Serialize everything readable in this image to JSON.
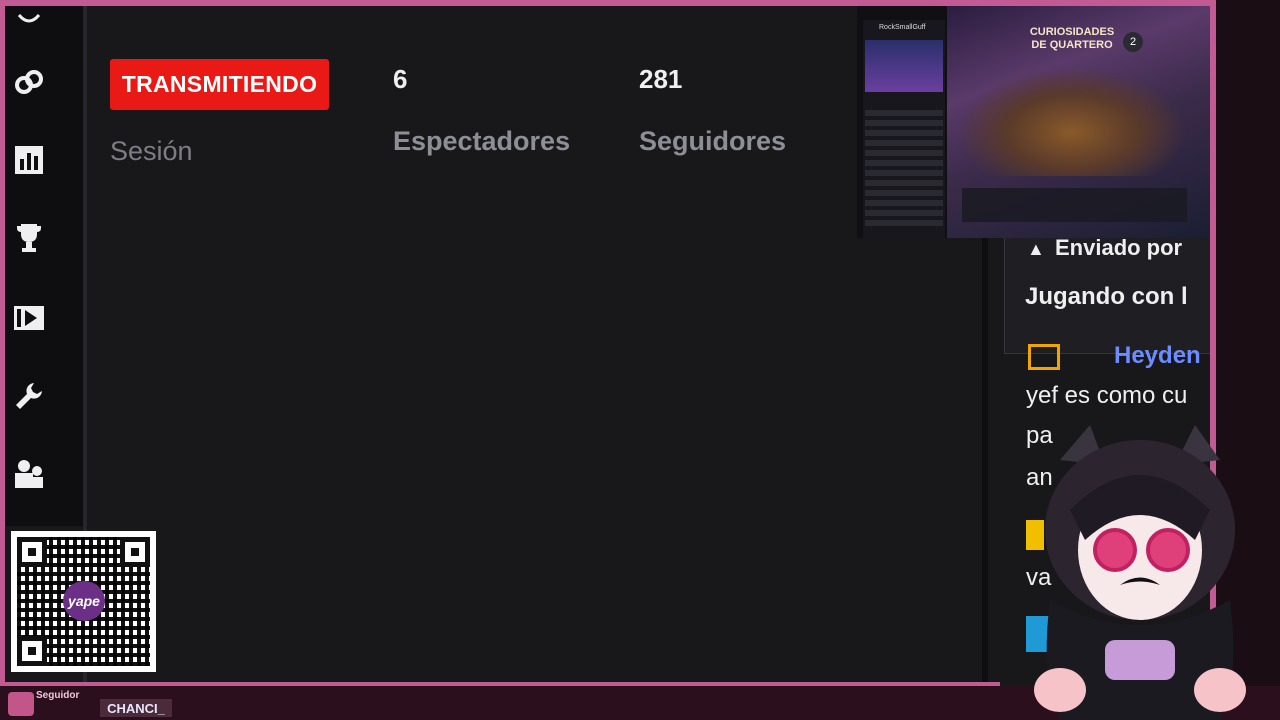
{
  "stream": {
    "status_badge": "TRANSMITIENDO",
    "session_label": "Sesión",
    "viewers_value": "6",
    "viewers_label": "Espectadores",
    "followers_value": "281",
    "followers_label": "Seguidores"
  },
  "sidebar": {
    "items": [
      {
        "icon": "link-icon"
      },
      {
        "icon": "bar-chart-icon"
      },
      {
        "icon": "trophy-icon"
      },
      {
        "icon": "video-play-icon"
      },
      {
        "icon": "wrench-icon"
      },
      {
        "icon": "users-icon"
      }
    ]
  },
  "chat": {
    "card_sender_prefix": "Enviado por",
    "card_message": "Jugando con l",
    "user_name": "Heyden",
    "line1": "yef es como cu",
    "line2": "pa",
    "line3": "an",
    "line4": "va"
  },
  "preview": {
    "title_line1": "CURIOSIDADES",
    "title_line2": "DE QUARTERO",
    "profile_name": "RockSmallGuff",
    "number_badge": "2"
  },
  "overlay": {
    "qr_text": "yape",
    "follow_label": "Seguidor",
    "follow_name": "CHANCI_"
  },
  "colors": {
    "frame": "#c25b94",
    "live": "#e91916",
    "background": "#18181b"
  }
}
